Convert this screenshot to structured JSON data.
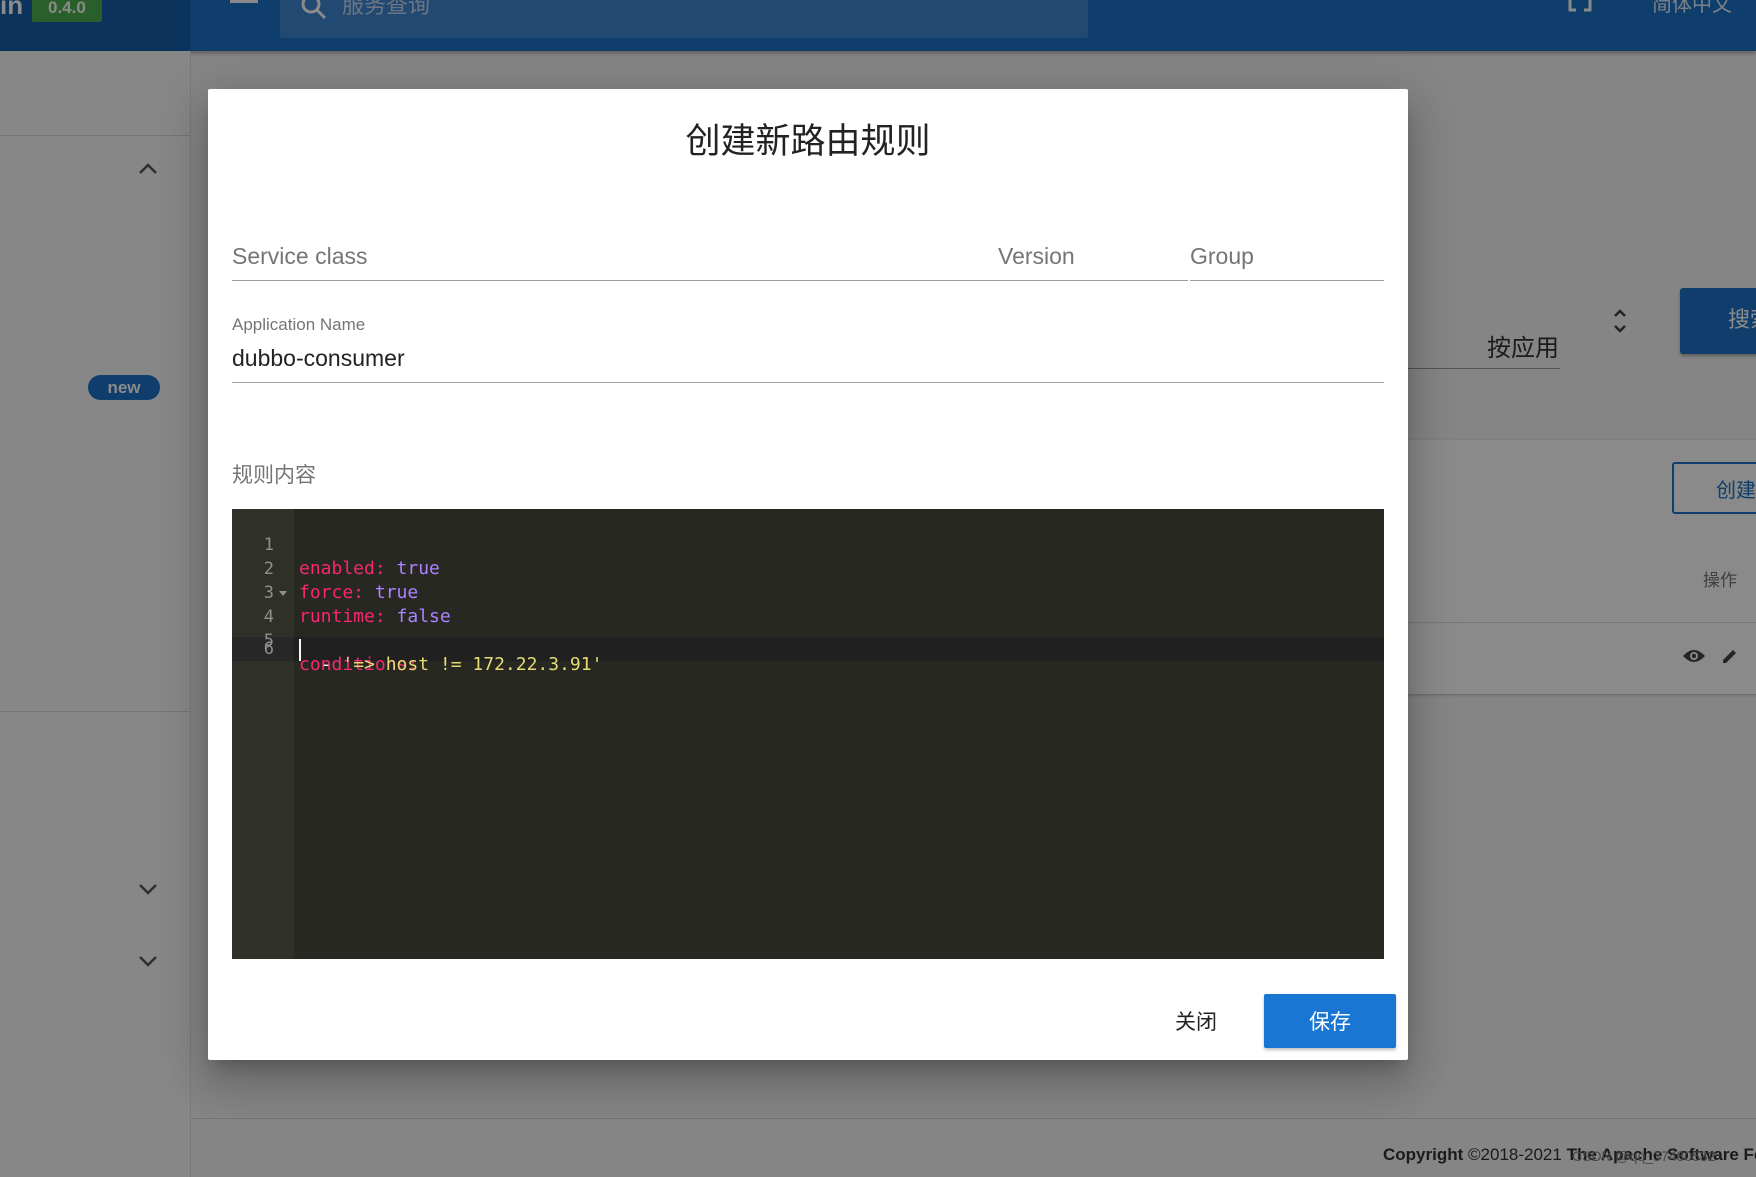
{
  "header": {
    "brand_text": "in",
    "version": "0.4.0",
    "search_placeholder": "服务查询",
    "language": "简体中文"
  },
  "sidebar": {
    "new_badge": "new"
  },
  "background": {
    "select_value": "按应用",
    "search_button": "搜索",
    "create_button": "创建",
    "actions_header": "操作",
    "copyright_prefix": "Copyright",
    "copyright_text": "©2018-2021",
    "copyright_org": "The Apache Software Foundation",
    "watermark": "CSDN @qq_37480532"
  },
  "dialog": {
    "title": "创建新路由规则",
    "service_class_placeholder": "Service class",
    "version_placeholder": "Version",
    "group_placeholder": "Group",
    "application_name_label": "Application Name",
    "application_name_value": "dubbo-consumer",
    "rule_content_label": "规则内容",
    "editor": {
      "lines": [
        {
          "number": "1",
          "key": "enabled:",
          "value": "true"
        },
        {
          "number": "2",
          "key": "force:",
          "value": "true"
        },
        {
          "number": "3",
          "key": "runtime:",
          "value": "false"
        },
        {
          "number": "4",
          "key": "conditions:",
          "value": ""
        },
        {
          "number": "5",
          "dash": "  - ",
          "string": "'=> host != 172.22.3.91'"
        },
        {
          "number": "6",
          "key": "",
          "value": ""
        }
      ]
    },
    "close_button": "关闭",
    "save_button": "保存"
  },
  "colors": {
    "primary": "#1976d2",
    "header": "#1e73c8",
    "version_badge": "#4caf50",
    "editor_bg": "#272822",
    "yaml_key": "#f92672",
    "yaml_bool": "#ae81ff",
    "yaml_string": "#e6db74"
  }
}
